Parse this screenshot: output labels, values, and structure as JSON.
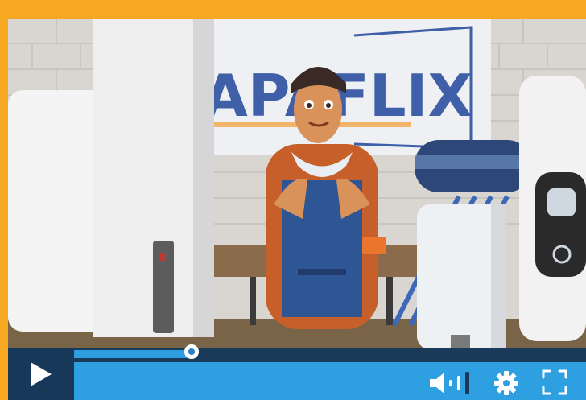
{
  "video": {
    "logo_text": "APAFLIX",
    "logo_color": "#f29a2e"
  },
  "playback": {
    "progress": 0.23
  },
  "controls": {
    "play_icon": "play-icon",
    "volume_icon": "volume-icon",
    "settings_icon": "gear-icon",
    "fullscreen_icon": "fullscreen-icon"
  },
  "colors": {
    "frame": "#f7a823",
    "control_bar": "#2e9fe0",
    "play_button_bg": "#173858",
    "progress_fill": "#2f9ee0"
  }
}
